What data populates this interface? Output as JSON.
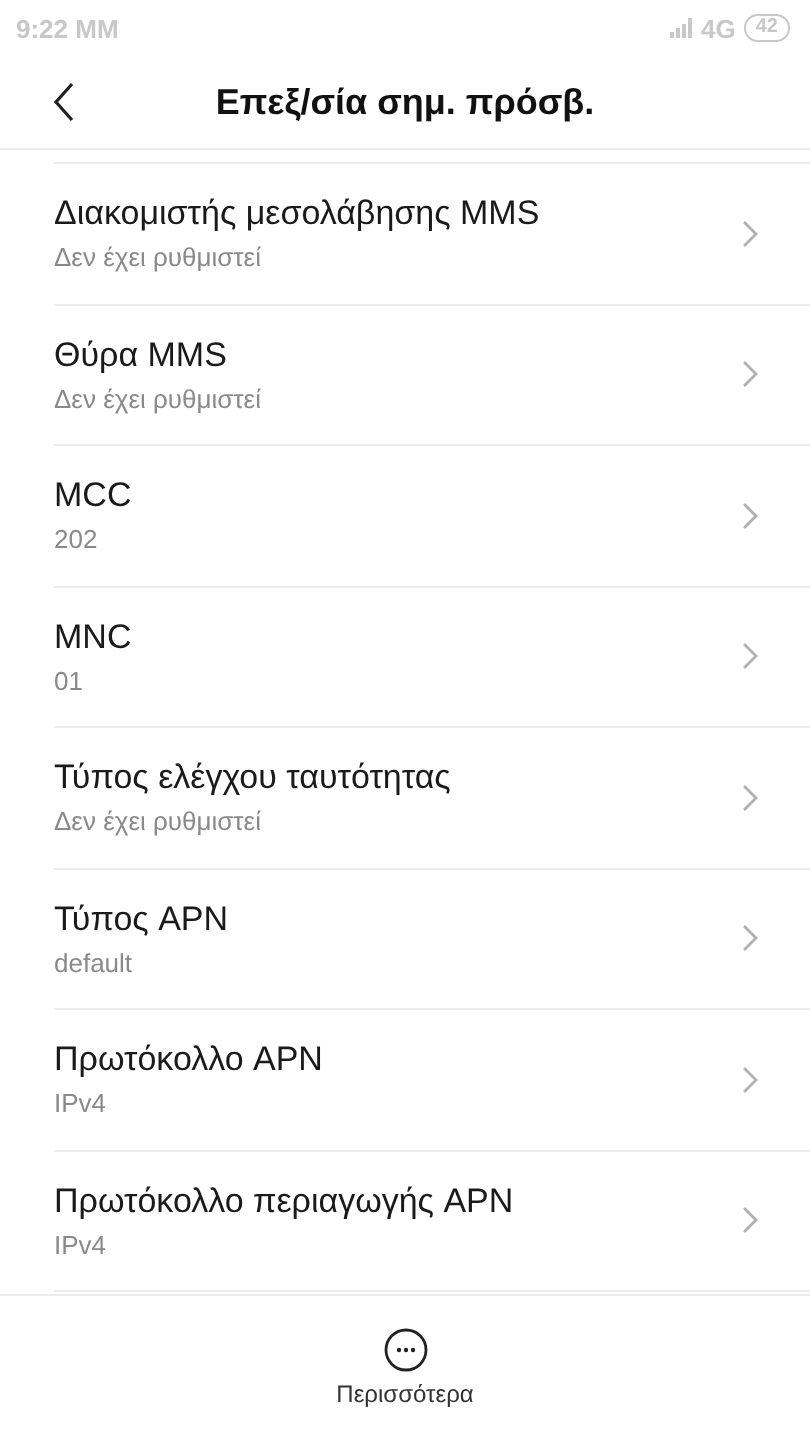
{
  "status_bar": {
    "time": "9:22 MM",
    "network": "4G",
    "battery": "42"
  },
  "header": {
    "title": "Επεξ/σία σημ. πρόσβ."
  },
  "settings": [
    {
      "title": "Διακομιστής μεσολάβησης MMS",
      "value": "Δεν έχει ρυθμιστεί"
    },
    {
      "title": "Θύρα MMS",
      "value": "Δεν έχει ρυθμιστεί"
    },
    {
      "title": "MCC",
      "value": "202"
    },
    {
      "title": "MNC",
      "value": "01"
    },
    {
      "title": "Τύπος ελέγχου ταυτότητας",
      "value": "Δεν έχει ρυθμιστεί"
    },
    {
      "title": "Τύπος APN",
      "value": "default"
    },
    {
      "title": "Πρωτόκολλο APN",
      "value": "IPv4"
    },
    {
      "title": "Πρωτόκολλο περιαγωγής APN",
      "value": "IPv4"
    }
  ],
  "footer": {
    "more_label": "Περισσότερα"
  }
}
